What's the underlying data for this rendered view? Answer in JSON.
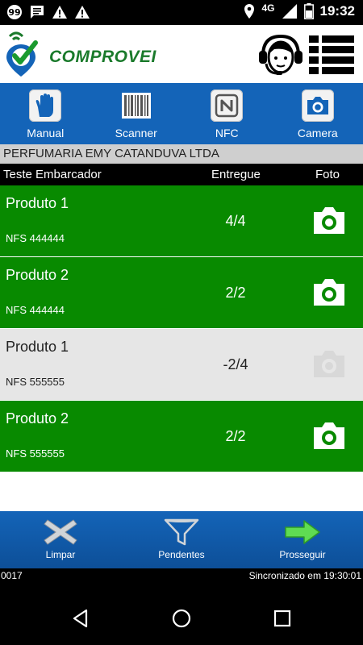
{
  "status": {
    "network": "4G",
    "time": "19:32",
    "icons_left": [
      "chat-bubble-icon",
      "message-icon",
      "warning-icon",
      "warning-icon"
    ],
    "icons_right": [
      "location-icon",
      "signal-icon",
      "battery-icon"
    ]
  },
  "header": {
    "logo_text": "COMPROVEI",
    "brand_green": "#1a7a2b",
    "brand_blue": "#1464b8"
  },
  "modes": [
    {
      "label": "Manual",
      "icon": "hand-icon"
    },
    {
      "label": "Scanner",
      "icon": "barcode-icon"
    },
    {
      "label": "NFC",
      "icon": "nfc-icon"
    },
    {
      "label": "Camera",
      "icon": "camera-icon"
    }
  ],
  "company": "PERFUMARIA EMY CATANDUVA LTDA",
  "columns": {
    "shipper": "Teste Embarcador",
    "delivered": "Entregue",
    "photo": "Foto"
  },
  "items": [
    {
      "name": "Produto 1",
      "nfs": "NFS 444444",
      "delivered": "4/4",
      "status": "done"
    },
    {
      "name": "Produto 2",
      "nfs": "NFS 444444",
      "delivered": "2/2",
      "status": "done"
    },
    {
      "name": "Produto 1",
      "nfs": "NFS 555555",
      "delivered": "-2/4",
      "status": "pending"
    },
    {
      "name": "Produto 2",
      "nfs": "NFS 555555",
      "delivered": "2/2",
      "status": "done"
    }
  ],
  "actions": {
    "clear": "Limpar",
    "pending": "Pendentes",
    "proceed": "Prosseguir"
  },
  "footer": {
    "code": "0017",
    "sync": "Sincronizado em 19:30:01"
  },
  "colors": {
    "done_row": "#088a00",
    "pending_row": "#e6e6e6",
    "toolbar_blue": "#1464b8"
  }
}
